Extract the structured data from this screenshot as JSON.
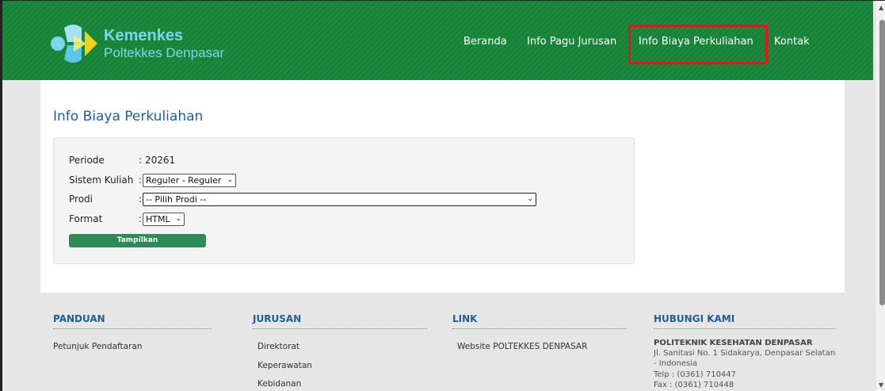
{
  "header": {
    "brand_line1": "Kemenkes",
    "brand_line2": "Poltekkes Denpasar",
    "nav": [
      {
        "label": "Beranda"
      },
      {
        "label": "Info Pagu Jurusan"
      },
      {
        "label": "Info Biaya Perkuliahan"
      },
      {
        "label": "Kontak"
      }
    ]
  },
  "page": {
    "title": "Info Biaya Perkuliahan"
  },
  "form": {
    "periode_label": "Periode",
    "periode_value": "20261",
    "sistem_label": "Sistem Kuliah",
    "sistem_value": "Reguler - Reguler",
    "prodi_label": "Prodi",
    "prodi_value": "-- Pilih Prodi --",
    "format_label": "Format",
    "format_value": "HTML",
    "submit_label": "Tampilkan",
    "colon": ":"
  },
  "footer": {
    "panduan": {
      "heading": "PANDUAN",
      "links": [
        "Petunjuk Pendaftaran"
      ]
    },
    "jurusan": {
      "heading": "JURUSAN",
      "links": [
        "Direktorat",
        "Keperawatan",
        "Kebidanan"
      ]
    },
    "link": {
      "heading": "LINK",
      "links": [
        "Website POLTEKKES DENPASAR"
      ]
    },
    "hubungi": {
      "heading": "HUBUNGI KAMI",
      "org": "POLITEKNIK KESEHATAN DENPASAR",
      "address1": "Jl. Sanitasi No. 1 Sidakarya, Denpasar Selatan",
      "address2": "- Indonesia",
      "telp": "Telp : (0361) 710447",
      "fax": "Fax : (0361) 710448"
    }
  },
  "colors": {
    "header_green": "#188c3c",
    "highlight_red": "#e4141b",
    "title_blue": "#1f5f96",
    "button_green": "#2e8b57",
    "brand_cyan": "#7ad7ef"
  }
}
